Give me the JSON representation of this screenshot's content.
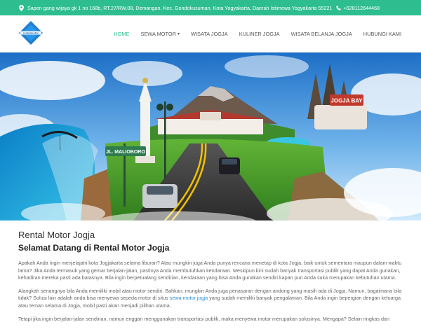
{
  "topbar": {
    "address": "Sapen gang wijaya gk 1 no 168b, RT.27/RW.08, Demangan, Kec. Gondokusuman, Kota Yogyakarta, Daerah Istimewa Yogyakarta 55221",
    "phone": "+628112644468",
    "icons": [
      "map-pin-icon",
      "phone-icon"
    ],
    "color": "#2ebd8f"
  },
  "header": {
    "logo_text": "rentalmotor jogja.com",
    "nav": [
      {
        "label": "HOME",
        "active": true
      },
      {
        "label": "SEWA MOTOR",
        "has_dropdown": true
      },
      {
        "label": "WISATA JOGJA"
      },
      {
        "label": "KULINER JOGJA"
      },
      {
        "label": "WISATA BELANJA JOGJA"
      },
      {
        "label": "HUBUNGI KAMI"
      }
    ]
  },
  "hero": {
    "sign_text": "JL. MALIOBORO",
    "building_sign": "JOGJA BAY"
  },
  "content": {
    "page_title": "Rental Motor Jogja",
    "welcome": "Selamat Datang di Rental Motor Jogja",
    "para1": "Apakah Anda ingin menjelajahi kota Jogjakarta selama liburan? Atau mungkin juga Anda punya rencana menetap di kota Jogja, baik untuk sementara maupun dalam waktu lama? Jika Anda termasuk yang gemar berjalan-jalan, pastinya Anda membutuhkan kendaraan. Meskipun kini sudah banyak transportasi publik yang dapat Anda gunakan, kehadiran mereka pasti ada batasnya. Bila ingin berpetualang sendirian, kendaraan yang bisa Anda gunakan sendiri kapan pun Anda suka merupakan kebutuhan utama.",
    "para2_before": "Alangkah senangnya bila Anda memiliki mobil atau motor sendiri. Bahkan, mungkin Anda juga penasaran dengan andong yang masih ada di Jogja. Namun, bagaimana bila tidak? Solusi lain adalah anda bisa menyewa sepeda motor di situs ",
    "para2_link": "sewa motor jogja",
    "para2_after": " yang sudah memiliki banyak pengalaman. Bila Anda ingin bepergian dengan keluarga atau teman selama di Jogja, mobil pasti akan menjadi pilihan utama.",
    "para3": "Tetapi jika ingin berjalan-jalan sendirian, namun enggan menggunakan transportasi publik, maka menyewa motor merupakan solusinya. Mengapa? Selain ringkas dan"
  }
}
